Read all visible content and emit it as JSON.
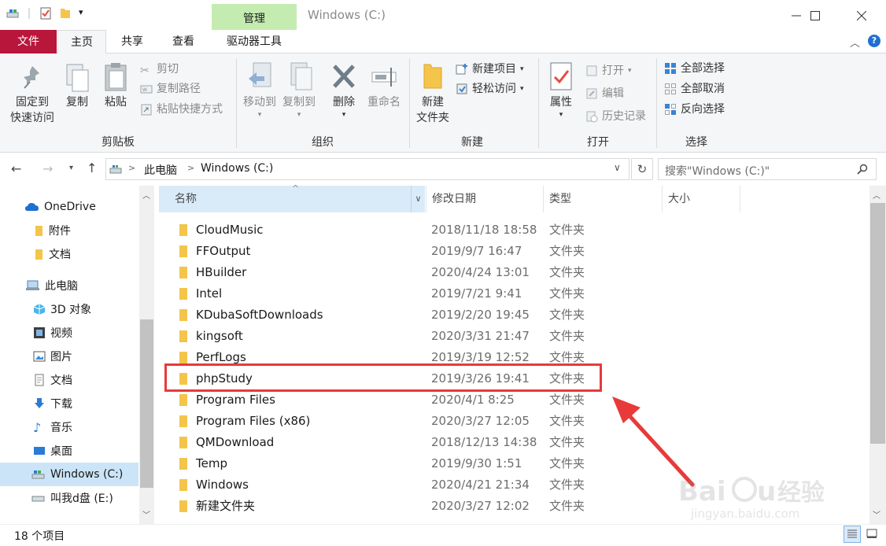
{
  "window": {
    "title": "Windows (C:)",
    "context_tab": "管理"
  },
  "tabs": [
    "文件",
    "主页",
    "共享",
    "查看",
    "驱动器工具"
  ],
  "ribbon": {
    "clipboard": {
      "label": "剪贴板",
      "pin_line1": "固定到",
      "pin_line2": "快速访问",
      "copy": "复制",
      "paste": "粘贴",
      "cut": "剪切",
      "copy_path": "复制路径",
      "paste_shortcut": "粘贴快捷方式"
    },
    "organize": {
      "label": "组织",
      "move_to": "移动到",
      "copy_to": "复制到",
      "delete": "删除",
      "rename": "重命名"
    },
    "new": {
      "label": "新建",
      "new_folder_line1": "新建",
      "new_folder_line2": "文件夹",
      "new_item": "新建项目",
      "easy_access": "轻松访问"
    },
    "open": {
      "label": "打开",
      "properties": "属性",
      "open": "打开",
      "edit": "编辑",
      "history": "历史记录"
    },
    "select": {
      "label": "选择",
      "select_all": "全部选择",
      "select_none": "全部取消",
      "invert": "反向选择"
    }
  },
  "address": {
    "segments": [
      "此电脑",
      "Windows (C:)"
    ],
    "separator": ">"
  },
  "search": {
    "placeholder": "搜索\"Windows (C:)\""
  },
  "nav": {
    "items": [
      {
        "label": "OneDrive",
        "icon": "cloud-icon"
      },
      {
        "label": "附件",
        "icon": "folder-icon"
      },
      {
        "label": "文档",
        "icon": "folder-icon"
      },
      {
        "label": "此电脑",
        "icon": "computer-icon"
      },
      {
        "label": "3D 对象",
        "icon": "cube-icon"
      },
      {
        "label": "视频",
        "icon": "video-icon"
      },
      {
        "label": "图片",
        "icon": "picture-icon"
      },
      {
        "label": "文档",
        "icon": "document-icon"
      },
      {
        "label": "下载",
        "icon": "download-icon"
      },
      {
        "label": "音乐",
        "icon": "music-icon"
      },
      {
        "label": "桌面",
        "icon": "desktop-icon"
      },
      {
        "label": "Windows (C:)",
        "icon": "drive-icon"
      },
      {
        "label": "叫我d盘 (E:)",
        "icon": "drive-icon"
      }
    ]
  },
  "columns": {
    "name": "名称",
    "date": "修改日期",
    "type": "类型",
    "size": "大小"
  },
  "files": [
    {
      "name": "CloudMusic",
      "date": "2018/11/18 18:58",
      "type": "文件夹"
    },
    {
      "name": "FFOutput",
      "date": "2019/9/7 16:47",
      "type": "文件夹"
    },
    {
      "name": "HBuilder",
      "date": "2020/4/24 13:01",
      "type": "文件夹"
    },
    {
      "name": "Intel",
      "date": "2019/7/21 9:41",
      "type": "文件夹"
    },
    {
      "name": "KDubaSoftDownloads",
      "date": "2019/2/20 19:45",
      "type": "文件夹"
    },
    {
      "name": "kingsoft",
      "date": "2020/3/31 21:47",
      "type": "文件夹"
    },
    {
      "name": "PerfLogs",
      "date": "2019/3/19 12:52",
      "type": "文件夹"
    },
    {
      "name": "phpStudy",
      "date": "2019/3/26 19:41",
      "type": "文件夹"
    },
    {
      "name": "Program Files",
      "date": "2020/4/1 8:25",
      "type": "文件夹"
    },
    {
      "name": "Program Files (x86)",
      "date": "2020/3/27 12:05",
      "type": "文件夹"
    },
    {
      "name": "QMDownload",
      "date": "2018/12/13 14:38",
      "type": "文件夹"
    },
    {
      "name": "Temp",
      "date": "2019/9/30 1:51",
      "type": "文件夹"
    },
    {
      "name": "Windows",
      "date": "2020/4/21 21:34",
      "type": "文件夹"
    },
    {
      "name": "新建文件夹",
      "date": "2020/3/27 12:02",
      "type": "文件夹"
    }
  ],
  "status": {
    "count": "18 个项目"
  },
  "watermark": {
    "text": "Baidu经验",
    "url": "jingyan.baidu.com"
  },
  "colors": {
    "file_tab": "#b9163c",
    "context_tab": "#c5ecb0",
    "highlight_box": "#e83a3a",
    "folder": "#f4c54a"
  }
}
